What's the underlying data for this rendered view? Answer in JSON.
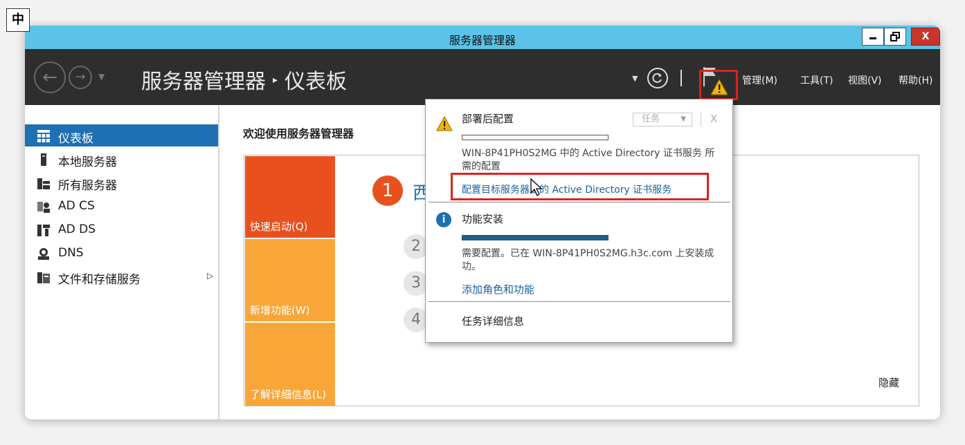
{
  "ime": {
    "label": "中"
  },
  "titlebar": {
    "title": "服务器管理器",
    "min": "—",
    "max": "🗗",
    "close": "X"
  },
  "header": {
    "app_name": "服务器管理器",
    "separator": "▸",
    "page_name": "仪表板",
    "back": "←",
    "forward": "→",
    "menus": [
      {
        "label": "管理(M)"
      },
      {
        "label": "工具(T)"
      },
      {
        "label": "视图(V)"
      },
      {
        "label": "帮助(H)"
      }
    ]
  },
  "sidebar": {
    "items": [
      {
        "label": "仪表板",
        "icon": "dashboard-icon"
      },
      {
        "label": "本地服务器",
        "icon": "server-icon"
      },
      {
        "label": "所有服务器",
        "icon": "servers-icon"
      },
      {
        "label": "AD CS",
        "icon": "certificate-icon"
      },
      {
        "label": "AD DS",
        "icon": "directory-icon"
      },
      {
        "label": "DNS",
        "icon": "dns-icon"
      },
      {
        "label": "文件和存储服务",
        "icon": "storage-icon",
        "arrow": "▷"
      }
    ]
  },
  "main": {
    "welcome": "欢迎使用服务器管理器",
    "tiles": [
      "快速启动(Q)",
      "新增功能(W)",
      "了解详细信息(L)"
    ],
    "step1_num": "1",
    "step1_text": "西",
    "steps": [
      "2",
      "3",
      "4"
    ],
    "hide": "隐藏"
  },
  "popup": {
    "section1": {
      "title": "部署后配置",
      "task_button": "任务",
      "close": "X",
      "progress": 0,
      "desc": "WIN-8P41PH0S2MG 中的 Active Directory 证书服务 所需的配置",
      "link": "配置目标服务器上的 Active Directory 证书服务"
    },
    "section2": {
      "title": "功能安装",
      "progress": 1,
      "desc": "需要配置。已在 WIN-8P41PH0S2MG.h3c.com 上安装成功。",
      "link": "添加角色和功能"
    },
    "details": "任务详细信息"
  },
  "colors": {
    "titlebar": "#5bc3e8",
    "header": "#2e2e2e",
    "active": "#1e6fb3",
    "tile_orange": "#e8511e",
    "tile_yellow": "#f8a638",
    "highlight": "#e0201b"
  }
}
